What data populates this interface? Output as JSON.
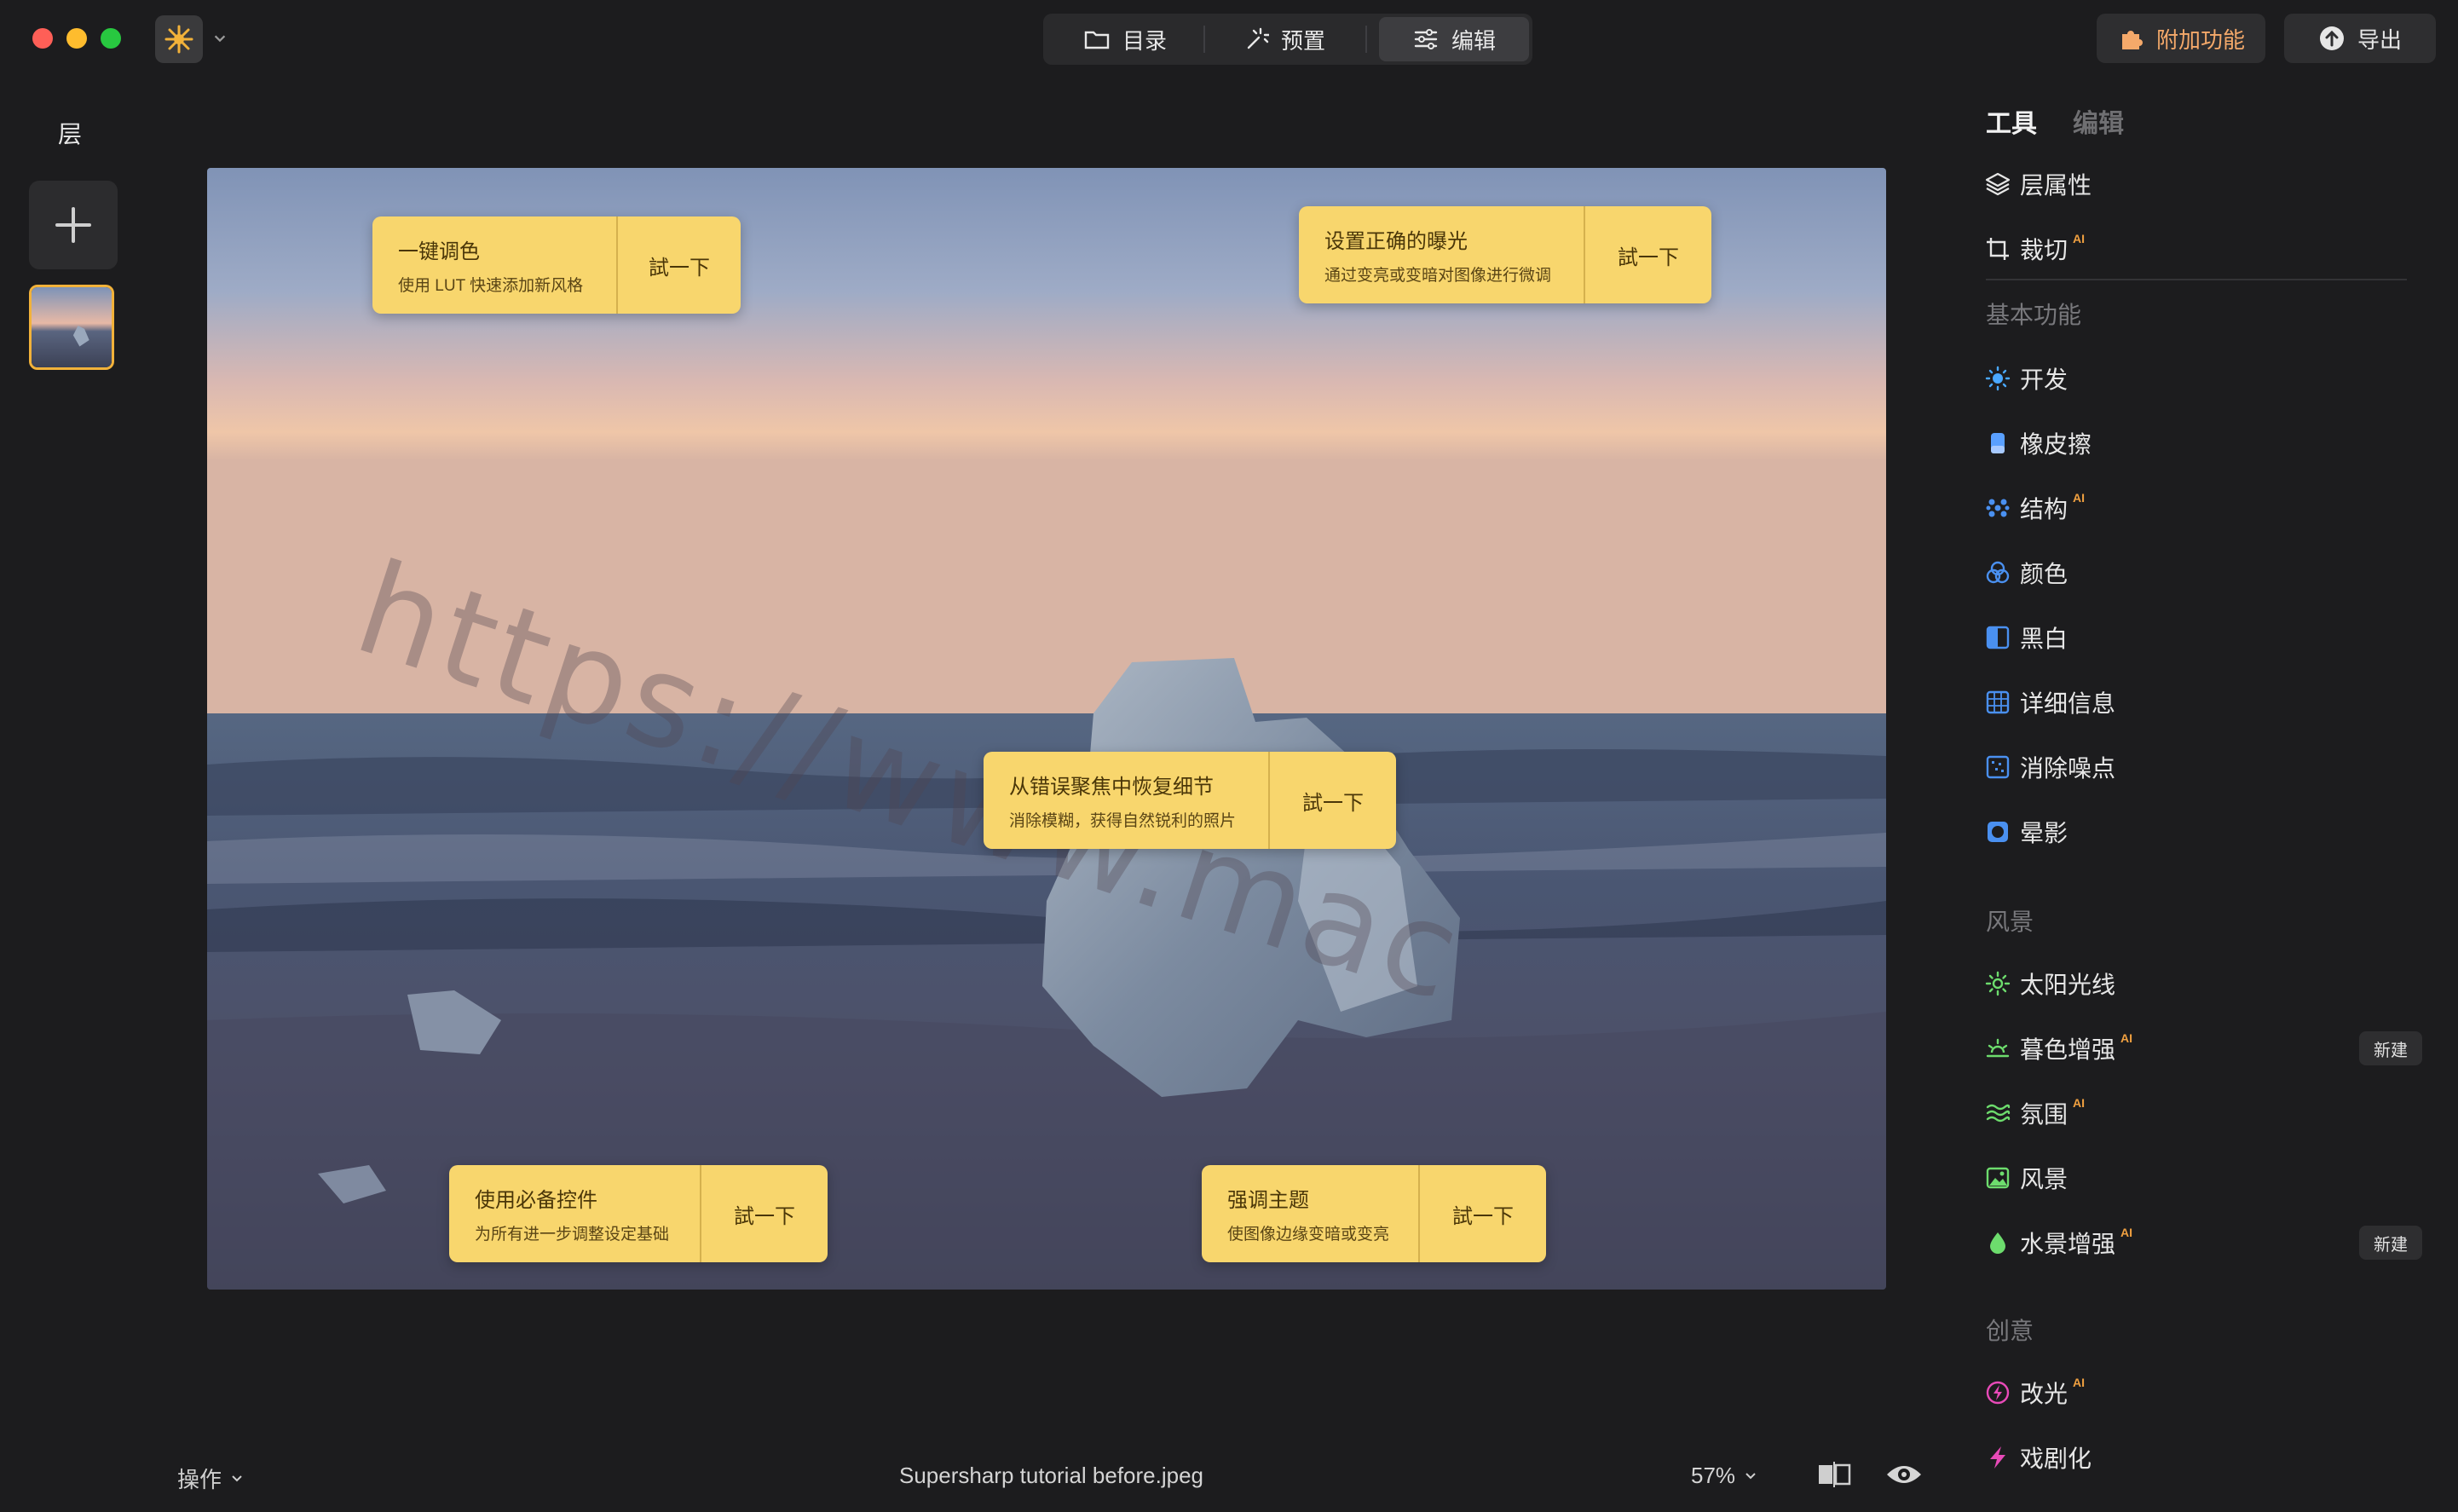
{
  "topbar": {
    "tabs": [
      {
        "label": "目录",
        "icon": "folder-icon"
      },
      {
        "label": "预置",
        "icon": "magic-wand-icon"
      },
      {
        "label": "编辑",
        "icon": "sliders-icon"
      }
    ],
    "active_tab": "编辑",
    "addon_label": "附加功能",
    "export_label": "导出"
  },
  "layers": {
    "title": "层"
  },
  "canvas": {
    "watermark": "https://www.mac",
    "tips": [
      {
        "title": "一键调色",
        "subtitle": "使用 LUT 快速添加新风格",
        "action": "試一下"
      },
      {
        "title": "设置正确的曝光",
        "subtitle": "通过变亮或变暗对图像进行微调",
        "action": "試一下"
      },
      {
        "title": "从错误聚焦中恢复细节",
        "subtitle": "消除模糊，获得自然锐利的照片",
        "action": "試一下"
      },
      {
        "title": "使用必备控件",
        "subtitle": "为所有进一步调整设定基础",
        "action": "試一下"
      },
      {
        "title": "强调主题",
        "subtitle": "使图像边缘变暗或变亮",
        "action": "試一下"
      }
    ]
  },
  "bottombar": {
    "operations_label": "操作",
    "filename": "Supersharp tutorial before.jpeg",
    "zoom": "57%"
  },
  "rightpanel": {
    "tabs": {
      "tools": "工具",
      "edit": "编辑"
    },
    "top_items": [
      {
        "label": "层属性",
        "icon": "layers-icon",
        "ai": ""
      },
      {
        "label": "裁切",
        "icon": "crop-icon",
        "ai": "AI"
      }
    ],
    "sections": [
      {
        "title": "基本功能",
        "items": [
          {
            "label": "开发",
            "icon": "sun-icon",
            "color": "#4aa8ff",
            "ai": ""
          },
          {
            "label": "橡皮擦",
            "icon": "eraser-icon",
            "color": "#5aa0ff",
            "ai": ""
          },
          {
            "label": "结构",
            "icon": "structure-icon",
            "color": "#4a90f0",
            "ai": "AI"
          },
          {
            "label": "颜色",
            "icon": "color-icon",
            "color": "#4a90f0",
            "ai": ""
          },
          {
            "label": "黑白",
            "icon": "bw-icon",
            "color": "#4a90f0",
            "ai": ""
          },
          {
            "label": "详细信息",
            "icon": "detail-icon",
            "color": "#4a90f0",
            "ai": ""
          },
          {
            "label": "消除噪点",
            "icon": "denoise-icon",
            "color": "#4a90f0",
            "ai": ""
          },
          {
            "label": "晕影",
            "icon": "vignette-icon",
            "color": "#4a90f0",
            "ai": ""
          }
        ]
      },
      {
        "title": "风景",
        "items": [
          {
            "label": "太阳光线",
            "icon": "sunrays-icon",
            "color": "#6ddc6d",
            "ai": "",
            "badge": ""
          },
          {
            "label": "暮色增强",
            "icon": "sunset-icon",
            "color": "#6ddc6d",
            "ai": "AI",
            "badge": "新建"
          },
          {
            "label": "氛围",
            "icon": "atmosphere-icon",
            "color": "#6ddc6d",
            "ai": "AI",
            "badge": ""
          },
          {
            "label": "风景",
            "icon": "landscape-icon",
            "color": "#6ddc6d",
            "ai": "",
            "badge": ""
          },
          {
            "label": "水景增强",
            "icon": "water-drop-icon",
            "color": "#6ddc6d",
            "ai": "AI",
            "badge": "新建"
          }
        ]
      },
      {
        "title": "创意",
        "items": [
          {
            "label": "改光",
            "icon": "relight-icon",
            "color": "#e84ab8",
            "ai": "AI"
          },
          {
            "label": "戏剧化",
            "icon": "dramatic-icon",
            "color": "#e84ab8",
            "ai": ""
          }
        ]
      }
    ]
  },
  "colors": {
    "accent_orange": "#f2b23a",
    "tip_yellow": "#f8d66d",
    "background": "#1c1c1e"
  }
}
